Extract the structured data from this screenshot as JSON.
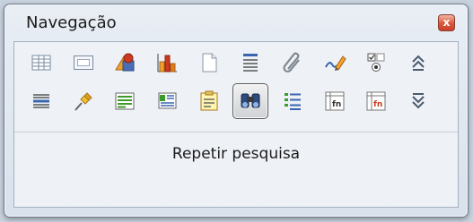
{
  "window": {
    "title": "Navegação",
    "close_icon": "close-icon"
  },
  "toolbar": {
    "row1": [
      {
        "name": "tables-icon"
      },
      {
        "name": "frames-icon"
      },
      {
        "name": "images-icon"
      },
      {
        "name": "ole-objects-icon"
      },
      {
        "name": "pages-icon"
      },
      {
        "name": "headings-icon"
      },
      {
        "name": "bookmarks-icon"
      },
      {
        "name": "drawings-icon"
      },
      {
        "name": "controls-icon"
      },
      {
        "name": "previous-object-icon"
      }
    ],
    "row2": [
      {
        "name": "sections-icon"
      },
      {
        "name": "pin-icon"
      },
      {
        "name": "text-frames-icon"
      },
      {
        "name": "comments-icon"
      },
      {
        "name": "reminder-icon"
      },
      {
        "name": "repeat-search-icon",
        "active": true
      },
      {
        "name": "table-formula-icon"
      },
      {
        "name": "fields-icon"
      },
      {
        "name": "wrong-table-formula-icon"
      },
      {
        "name": "next-object-icon"
      }
    ]
  },
  "status": {
    "label": "Repetir pesquisa"
  },
  "colors": {
    "accent_red": "#cc3a1f",
    "accent_green": "#3d9b2b",
    "accent_orange": "#f0a02b",
    "accent_blue": "#4a6fb5"
  }
}
